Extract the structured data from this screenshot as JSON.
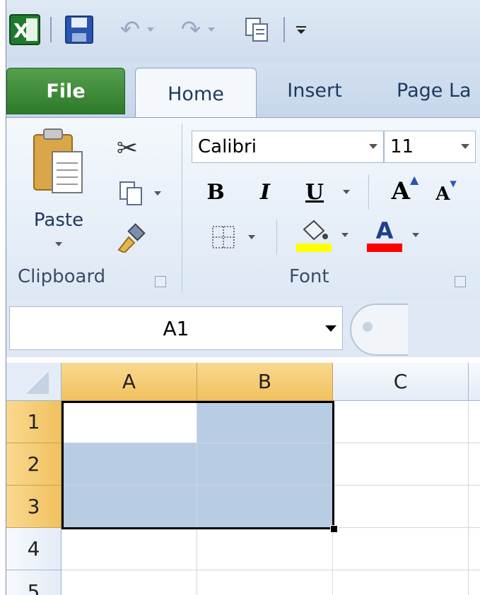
{
  "qat": {
    "excel_icon": "excel-logo-icon",
    "save_icon": "save-icon",
    "undo_icon": "undo-icon",
    "redo_icon": "redo-icon",
    "copy_icon": "copy-icon",
    "customize_icon": "customize-qat-icon"
  },
  "tabs": [
    "File",
    "Home",
    "Insert",
    "Page La"
  ],
  "ribbon": {
    "clipboard": {
      "paste_label": "Paste",
      "group_label": "Clipboard"
    },
    "font": {
      "font_name": "Calibri",
      "font_size": "11",
      "bold": "B",
      "italic": "I",
      "underline": "U",
      "grow": "A",
      "shrink": "A",
      "font_color": "A",
      "group_label": "Font",
      "fill_color": "#ffff00",
      "text_color": "#ff0000"
    }
  },
  "formula_bar": {
    "name_box": "A1"
  },
  "grid": {
    "columns": [
      "A",
      "B",
      "C"
    ],
    "rows": [
      "1",
      "2",
      "3",
      "4",
      "5"
    ],
    "selection": "A1:B3",
    "active_cell": "A1"
  }
}
